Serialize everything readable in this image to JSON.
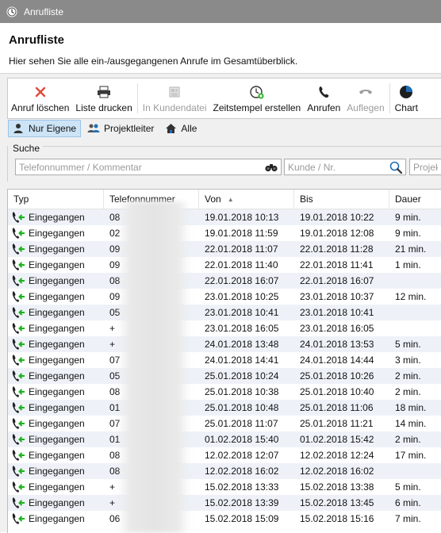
{
  "window": {
    "title": "Anrufliste"
  },
  "header": {
    "title": "Anrufliste",
    "subtitle": "Hier sehen Sie alle ein-/ausgegangenen Anrufe im Gesamtüberblick."
  },
  "toolbar": {
    "delete_label": "Anruf löschen",
    "print_label": "Liste drucken",
    "customer_file_label": "In Kundendatei",
    "timestamp_label": "Zeitstempel erstellen",
    "call_label": "Anrufen",
    "hangup_label": "Auflegen",
    "chart_label": "Chart"
  },
  "filters": {
    "own_label": "Nur Eigene",
    "projectlead_label": "Projektleiter",
    "all_label": "Alle"
  },
  "search": {
    "label": "Suche",
    "phone_placeholder": "Telefonnummer / Kommentar",
    "customer_placeholder": "Kunde / Nr.",
    "project_placeholder": "Projekt"
  },
  "table": {
    "columns": {
      "typ": "Typ",
      "telefon": "Telefonnummer",
      "von": "Von",
      "bis": "Bis",
      "dauer": "Dauer"
    },
    "rows": [
      {
        "typ": "Eingegangen",
        "telefon": "08",
        "von": "19.01.2018 10:13",
        "bis": "19.01.2018 10:22",
        "dauer": "9 min."
      },
      {
        "typ": "Eingegangen",
        "telefon": "02",
        "von": "19.01.2018 11:59",
        "bis": "19.01.2018 12:08",
        "dauer": "9 min."
      },
      {
        "typ": "Eingegangen",
        "telefon": "09",
        "von": "22.01.2018 11:07",
        "bis": "22.01.2018 11:28",
        "dauer": "21 min."
      },
      {
        "typ": "Eingegangen",
        "telefon": "09",
        "von": "22.01.2018 11:40",
        "bis": "22.01.2018 11:41",
        "dauer": "1 min."
      },
      {
        "typ": "Eingegangen",
        "telefon": "08",
        "von": "22.01.2018 16:07",
        "bis": "22.01.2018 16:07",
        "dauer": ""
      },
      {
        "typ": "Eingegangen",
        "telefon": "09",
        "von": "23.01.2018 10:25",
        "bis": "23.01.2018 10:37",
        "dauer": "12 min."
      },
      {
        "typ": "Eingegangen",
        "telefon": "05",
        "von": "23.01.2018 10:41",
        "bis": "23.01.2018 10:41",
        "dauer": ""
      },
      {
        "typ": "Eingegangen",
        "telefon": "+",
        "von": "23.01.2018 16:05",
        "bis": "23.01.2018 16:05",
        "dauer": ""
      },
      {
        "typ": "Eingegangen",
        "telefon": "+",
        "von": "24.01.2018 13:48",
        "bis": "24.01.2018 13:53",
        "dauer": "5 min."
      },
      {
        "typ": "Eingegangen",
        "telefon": "07",
        "von": "24.01.2018 14:41",
        "bis": "24.01.2018 14:44",
        "dauer": "3 min."
      },
      {
        "typ": "Eingegangen",
        "telefon": "05",
        "von": "25.01.2018 10:24",
        "bis": "25.01.2018 10:26",
        "dauer": "2 min."
      },
      {
        "typ": "Eingegangen",
        "telefon": "08",
        "von": "25.01.2018 10:38",
        "bis": "25.01.2018 10:40",
        "dauer": "2 min."
      },
      {
        "typ": "Eingegangen",
        "telefon": "01",
        "von": "25.01.2018 10:48",
        "bis": "25.01.2018 11:06",
        "dauer": "18 min."
      },
      {
        "typ": "Eingegangen",
        "telefon": "07",
        "von": "25.01.2018 11:07",
        "bis": "25.01.2018 11:21",
        "dauer": "14 min."
      },
      {
        "typ": "Eingegangen",
        "telefon": "01",
        "von": "01.02.2018 15:40",
        "bis": "01.02.2018 15:42",
        "dauer": "2 min."
      },
      {
        "typ": "Eingegangen",
        "telefon": "08",
        "von": "12.02.2018 12:07",
        "bis": "12.02.2018 12:24",
        "dauer": "17 min."
      },
      {
        "typ": "Eingegangen",
        "telefon": "08",
        "von": "12.02.2018 16:02",
        "bis": "12.02.2018 16:02",
        "dauer": ""
      },
      {
        "typ": "Eingegangen",
        "telefon": "+",
        "von": "15.02.2018 13:33",
        "bis": "15.02.2018 13:38",
        "dauer": "5 min."
      },
      {
        "typ": "Eingegangen",
        "telefon": "+",
        "von": "15.02.2018 13:39",
        "bis": "15.02.2018 13:45",
        "dauer": "6 min."
      },
      {
        "typ": "Eingegangen",
        "telefon": "06",
        "von": "15.02.2018 15:09",
        "bis": "15.02.2018 15:16",
        "dauer": "7 min."
      }
    ]
  },
  "colors": {
    "accent": "#1f6fb5",
    "incoming_arrow": "#1db31d",
    "delete_red": "#e04a3a",
    "row_alt": "#eef2f8",
    "titlebar": "#8a8a8a"
  }
}
